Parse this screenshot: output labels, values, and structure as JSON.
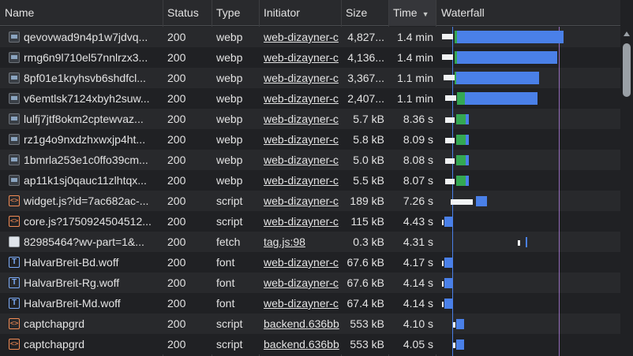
{
  "columns": {
    "name": "Name",
    "status": "Status",
    "type": "Type",
    "initiator": "Initiator",
    "size": "Size",
    "time": "Time",
    "waterfall": "Waterfall"
  },
  "sort_indicator": "▼",
  "rows": [
    {
      "icon": "image-file-icon",
      "name": "qevovwad9n4p1w7jdvq...",
      "status": "200",
      "type": "webp",
      "initiator": "web-dizayner-c",
      "size": "4,827...",
      "time": "1.4 min"
    },
    {
      "icon": "image-file-icon",
      "name": "rmg6n9l710el57nnlrzx3...",
      "status": "200",
      "type": "webp",
      "initiator": "web-dizayner-c",
      "size": "4,136...",
      "time": "1.4 min"
    },
    {
      "icon": "image-file-icon",
      "name": "8pf01e1kryhsvb6shdfcl...",
      "status": "200",
      "type": "webp",
      "initiator": "web-dizayner-c",
      "size": "3,367...",
      "time": "1.1 min"
    },
    {
      "icon": "image-file-icon",
      "name": "v6emtlsk7124xbyh2suw...",
      "status": "200",
      "type": "webp",
      "initiator": "web-dizayner-c",
      "size": "2,407...",
      "time": "1.1 min"
    },
    {
      "icon": "image-file-icon",
      "name": "lulfj7jtf8okm2cptewvaz...",
      "status": "200",
      "type": "webp",
      "initiator": "web-dizayner-c",
      "size": "5.7 kB",
      "time": "8.36 s"
    },
    {
      "icon": "image-file-icon",
      "name": "rz1g4o9nxdzhxwxjp4ht...",
      "status": "200",
      "type": "webp",
      "initiator": "web-dizayner-c",
      "size": "5.8 kB",
      "time": "8.09 s"
    },
    {
      "icon": "image-file-icon",
      "name": "1bmrla253e1c0ffo39cm...",
      "status": "200",
      "type": "webp",
      "initiator": "web-dizayner-c",
      "size": "5.0 kB",
      "time": "8.08 s"
    },
    {
      "icon": "image-file-icon",
      "name": "ap11k1sj0qauc11zlhtqx...",
      "status": "200",
      "type": "webp",
      "initiator": "web-dizayner-c",
      "size": "5.5 kB",
      "time": "8.07 s"
    },
    {
      "icon": "script-file-icon",
      "name": "widget.js?id=7ac682ac-...",
      "status": "200",
      "type": "script",
      "initiator": "web-dizayner-c",
      "size": "189 kB",
      "time": "7.26 s"
    },
    {
      "icon": "script-file-icon",
      "name": "core.js?1750924504512...",
      "status": "200",
      "type": "script",
      "initiator": "web-dizayner-c",
      "size": "115 kB",
      "time": "4.43 s"
    },
    {
      "icon": "fetch-file-icon",
      "name": "82985464?wv-part=1&...",
      "status": "200",
      "type": "fetch",
      "initiator": "tag.js:98",
      "size": "0.3 kB",
      "time": "4.31 s"
    },
    {
      "icon": "font-file-icon",
      "name": "HalvarBreit-Bd.woff",
      "status": "200",
      "type": "font",
      "initiator": "web-dizayner-c",
      "size": "67.6 kB",
      "time": "4.17 s"
    },
    {
      "icon": "font-file-icon",
      "name": "HalvarBreit-Rg.woff",
      "status": "200",
      "type": "font",
      "initiator": "web-dizayner-c",
      "size": "67.6 kB",
      "time": "4.14 s"
    },
    {
      "icon": "font-file-icon",
      "name": "HalvarBreit-Md.woff",
      "status": "200",
      "type": "font",
      "initiator": "web-dizayner-c",
      "size": "67.4 kB",
      "time": "4.14 s"
    },
    {
      "icon": "script-file-icon",
      "name": "captchapgrd",
      "status": "200",
      "type": "script",
      "initiator": "backend.636bb",
      "size": "553 kB",
      "time": "4.10 s"
    },
    {
      "icon": "script-file-icon",
      "name": "captchapgrd",
      "status": "200",
      "type": "script",
      "initiator": "backend.636bb",
      "size": "553 kB",
      "time": "4.05 s"
    }
  ],
  "colors": {
    "waiting": "#f1f3f4",
    "ttfb": "#34a853",
    "download": "#4a80e8",
    "dom_content_loaded": "#4a80e8",
    "load": "#e06060"
  }
}
